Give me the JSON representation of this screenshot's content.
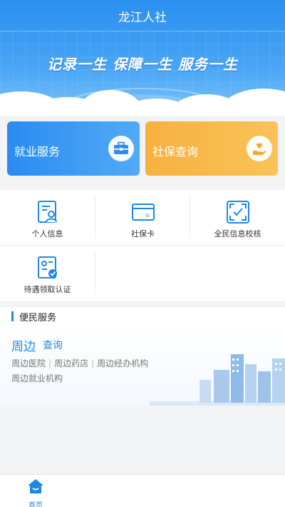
{
  "header": {
    "title": "龙江人社",
    "slogan": "记录一生 保障一生 服务一生"
  },
  "cards": [
    {
      "label": "就业服务",
      "icon": "briefcase-icon",
      "color": "#2a8cf0"
    },
    {
      "label": "社保查询",
      "icon": "heart-hand-icon",
      "color": "#f7b13d"
    }
  ],
  "grid": {
    "items": [
      {
        "label": "个人信息",
        "icon": "person-document-icon"
      },
      {
        "label": "社保卡",
        "icon": "si-card-icon",
        "card_text": "SI"
      },
      {
        "label": "全民信息校核",
        "icon": "scan-person-icon"
      },
      {
        "label": "待遇领取认证",
        "icon": "verified-person-icon"
      }
    ]
  },
  "services": {
    "title": "便民服务",
    "nearby_word1": "周边",
    "nearby_word2": "查询",
    "links": [
      "周边医院",
      "周边药店",
      "周边经办机构",
      "周边就业机构"
    ]
  },
  "tabbar": {
    "items": [
      {
        "label": "首页",
        "icon": "home-icon",
        "active": true
      }
    ]
  },
  "colors": {
    "accent": "#1e88e5",
    "jy_card": "#2a8cf0",
    "sb_card": "#f7b13d"
  }
}
